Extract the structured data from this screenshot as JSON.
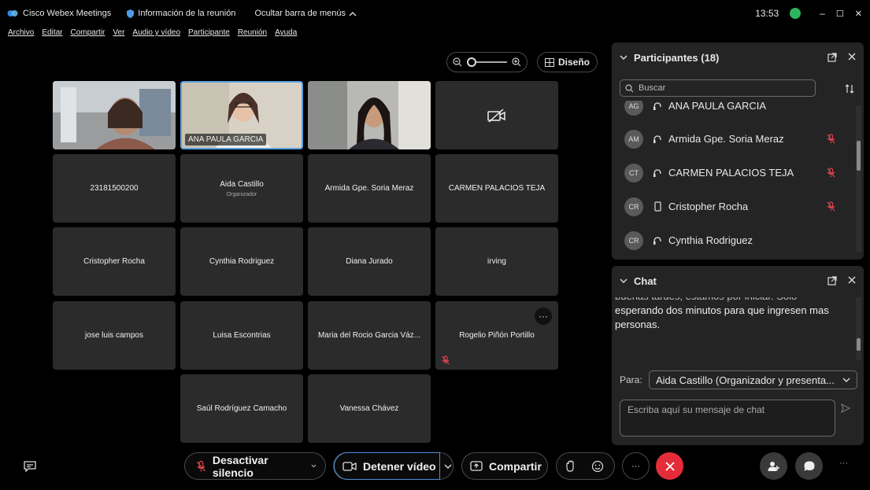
{
  "titlebar": {
    "app_name": "Cisco Webex Meetings",
    "meeting_info": "Información de la reunión",
    "hide_menu": "Ocultar barra de menús",
    "time": "13:53",
    "minimize": "–",
    "maximize": "☐",
    "close": "✕"
  },
  "menu": [
    "Archivo",
    "Editar",
    "Compartir",
    "Ver",
    "Audio y vídeo",
    "Participante",
    "Reunión",
    "Ayuda"
  ],
  "layout_button": "Diseño",
  "tiles": {
    "ana_label": "ANA PAULA GARCIA",
    "t_23181500200": "23181500200",
    "aida": "Aida Castillo",
    "aida_role": "Organizador",
    "armida": "Armida Gpe. Soria Meraz",
    "carmen": "CARMEN PALACIOS TEJA",
    "cristopher": "Cristopher Rocha",
    "cynthia": "Cynthia Rodriguez",
    "diana": "Diana Jurado",
    "irving": "irving",
    "jose": "jose luis campos",
    "luisa": "Luisa Escontrias",
    "maria": "Maria del Rocio Garcia Váz...",
    "rogelio": "Rogelio Piñón Portillo",
    "saul": "Saúl Rodríguez Camacho",
    "vanessa": "Vanessa Chávez"
  },
  "participants": {
    "title": "Participantes (18)",
    "search_placeholder": "Buscar",
    "rows": [
      {
        "initials": "AG",
        "name": "ANA PAULA GARCIA"
      },
      {
        "initials": "AM",
        "name": "Armida Gpe. Soria Meraz"
      },
      {
        "initials": "CT",
        "name": "CARMEN PALACIOS TEJA"
      },
      {
        "initials": "CR",
        "name": "Cristopher Rocha"
      },
      {
        "initials": "CR",
        "name": "Cynthia Rodriguez"
      }
    ]
  },
  "chat": {
    "title": "Chat",
    "message_partial": "buenas tardes, estamos por iniciar. Solo",
    "message": "esperando dos minutos para que ingresen mas personas.",
    "to_label": "Para:",
    "to_value": "Aida Castillo (Organizador y presenta...",
    "input_placeholder": "Escriba aquí su mensaje de chat"
  },
  "toolbar": {
    "mute": "Desactivar silencio",
    "stop_video": "Detener vídeo",
    "share": "Compartir",
    "more": "···"
  },
  "colors": {
    "accent_blue": "#5aa0e0",
    "mute_red": "#e0454f",
    "end_red": "#e52d3a",
    "status_green": "#2fb55d"
  }
}
